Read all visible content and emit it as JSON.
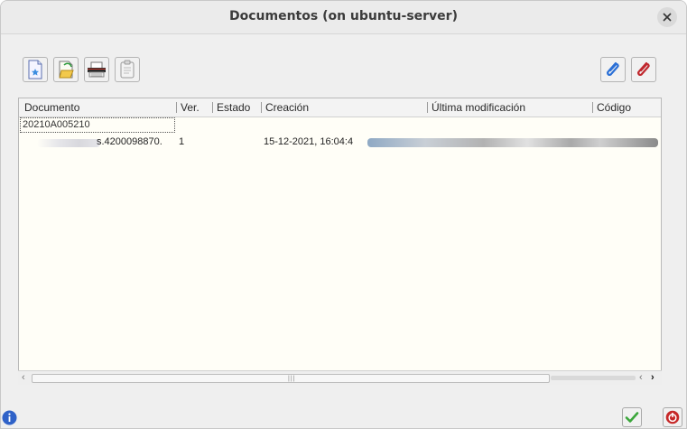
{
  "window": {
    "title": "Documentos (on ubuntu-server)",
    "close_icon": "close-icon"
  },
  "toolbar": {
    "buttons": [
      {
        "name": "new-document-button",
        "icon": "new-document-icon"
      },
      {
        "name": "open-document-button",
        "icon": "open-document-icon"
      },
      {
        "name": "scan-document-button",
        "icon": "scanner-icon"
      },
      {
        "name": "view-document-button",
        "icon": "document-view-icon"
      },
      {
        "name": "attach-blue-button",
        "icon": "blue-paperclip-icon"
      },
      {
        "name": "attach-red-button",
        "icon": "red-paperclip-icon"
      }
    ]
  },
  "table": {
    "columns": [
      "Documento",
      "Ver.",
      "Estado",
      "Creación",
      "Última modificación",
      "Código"
    ],
    "group_row": "20210A005210",
    "rows": [
      {
        "documento": "s.4200098870.",
        "ver": "1",
        "estado": "",
        "creacion": "15-12-2021, 16:04:4"
      }
    ]
  },
  "footer": {
    "info_icon": "info-icon",
    "accept_icon": "checkmark-icon",
    "cancel_icon": "power-icon"
  },
  "colors": {
    "table_bg": "#fffef7",
    "accent_blue": "#2a6fd6",
    "accent_red": "#c0272d",
    "accept_green": "#3aa63a"
  }
}
